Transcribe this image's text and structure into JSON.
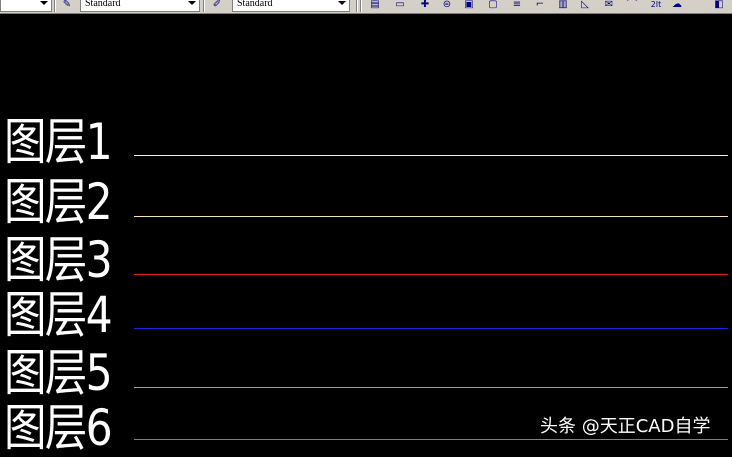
{
  "toolbar": {
    "text_style_value": "Standard",
    "dim_style_value": "Standard",
    "icons": [
      "properties-icon",
      "save-icon",
      "crosshair-icon",
      "print-icon",
      "image-icon",
      "preview-icon",
      "hatch-icon",
      "dimension-icon",
      "grid-icon",
      "angle-icon",
      "envelope-icon",
      "polyline-icon",
      "text-height-icon",
      "cloud-icon",
      "layers-icon"
    ],
    "icon_glyphs": [
      "▤",
      "▭",
      "✚",
      "⊜",
      "▣",
      "▢",
      "≡",
      "⌐",
      "▥",
      "◺",
      "✉",
      "⌒",
      "2It",
      "☁",
      "◧"
    ]
  },
  "layers": [
    {
      "label": "图层1",
      "color": "#f0f0f0"
    },
    {
      "label": "图层2",
      "color": "#f5e6b0"
    },
    {
      "label": "图层3",
      "color": "#e02020"
    },
    {
      "label": "图层4",
      "color": "#2020e0"
    },
    {
      "label": "图层5",
      "color": "#50d050"
    },
    {
      "label": "图层6",
      "color": "#e040e0"
    }
  ],
  "watermark": "头条 @天正CAD自学"
}
